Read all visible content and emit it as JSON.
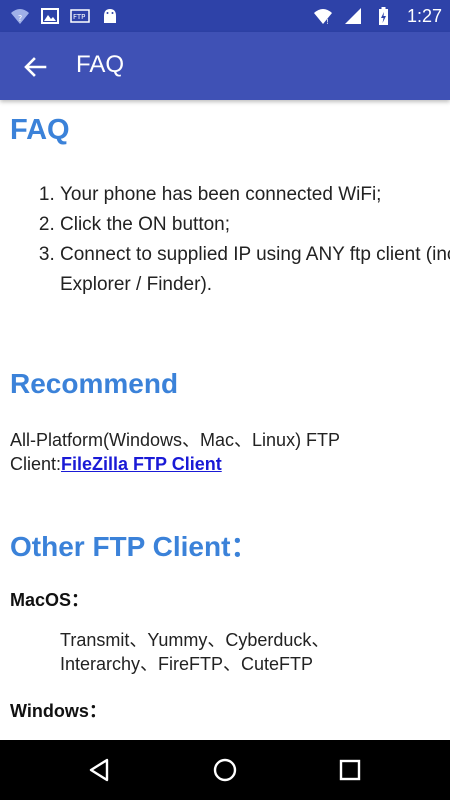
{
  "status_bar": {
    "time": "1:27",
    "left_icons": [
      "wifi-question-icon",
      "image-icon",
      "ftp-icon",
      "android-icon"
    ],
    "right_icons": [
      "wifi-icon",
      "signal-icon",
      "battery-charging-icon"
    ]
  },
  "app_bar": {
    "title": "FAQ",
    "back_icon": "arrow-back-icon"
  },
  "content": {
    "faq_heading": "FAQ",
    "steps": [
      "Your phone has been connected WiFi;",
      "Click the ON button;",
      "Connect to supplied IP using ANY ftp client (inc Explorer / Finder)."
    ],
    "recommend_heading": "Recommend",
    "recommend_text": "All-Platform(Windows、Mac、Linux) FTP Client:",
    "recommend_link": "FileZilla FTP Client",
    "other_heading": "Other FTP Client：",
    "macos_label": "MacOS：",
    "macos_clients": "Transmit、Yummy、Cyberduck、Interarchy、FireFTP、CuteFTP",
    "windows_label": "Windows："
  },
  "nav_bar": {
    "buttons": [
      "back-triangle-icon",
      "home-circle-icon",
      "recents-square-icon"
    ]
  },
  "colors": {
    "status_bar": "#2e42a8",
    "app_bar": "#3f51b5",
    "heading": "#3b82d9",
    "link": "#1a1ad6"
  }
}
